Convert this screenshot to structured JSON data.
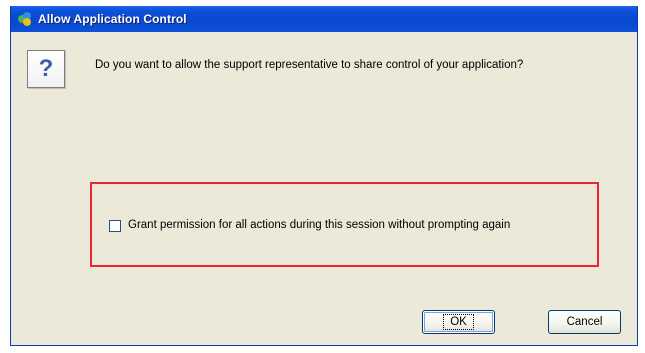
{
  "dialog": {
    "title": "Allow Application Control",
    "title_icon": "application-share-icon",
    "message_icon": "question-mark-icon",
    "message_icon_glyph": "?",
    "message": "Do you want to allow the support representative to share control of your application?",
    "checkbox": {
      "label": "Grant permission for all actions during this session without prompting again",
      "checked": false
    },
    "buttons": {
      "ok_label": "OK",
      "cancel_label": "Cancel"
    }
  },
  "colors": {
    "titlebar": "#0a47cf",
    "dialog_background": "#ece9d8",
    "highlight_border": "#e8282f"
  }
}
